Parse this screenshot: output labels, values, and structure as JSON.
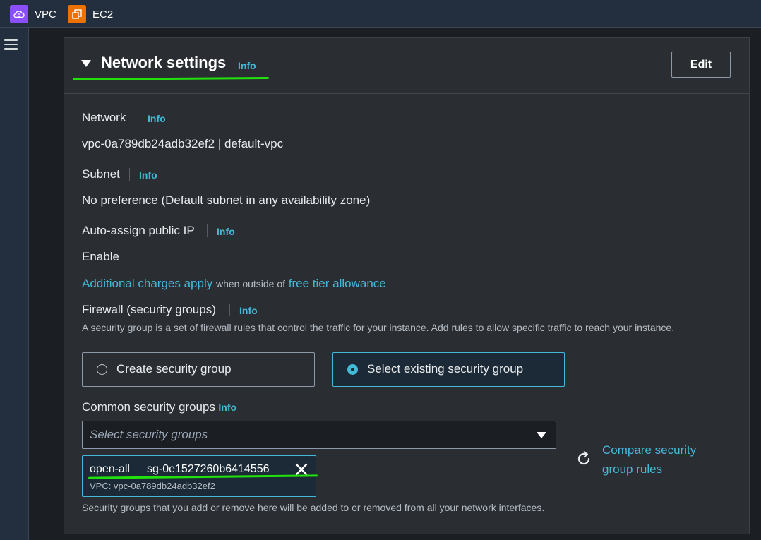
{
  "topbar": {
    "services": [
      {
        "label": "VPC",
        "icon": "vpc-cloud-icon",
        "color": "#8c4fff"
      },
      {
        "label": "EC2",
        "icon": "ec2-instance-icon",
        "color": "#ed7100"
      }
    ]
  },
  "sidebar": {
    "menu_icon": "hamburger-menu-icon"
  },
  "network_settings": {
    "title": "Network settings",
    "info": "Info",
    "edit_label": "Edit",
    "network": {
      "label": "Network",
      "info": "Info",
      "value": "vpc-0a789db24adb32ef2 | default-vpc"
    },
    "subnet": {
      "label": "Subnet",
      "info": "Info",
      "value": "No preference (Default subnet in any availability zone)"
    },
    "public_ip": {
      "label": "Auto-assign public IP",
      "info": "Info",
      "value": "Enable"
    },
    "charges": {
      "link1": "Additional charges apply",
      "text": "when outside of",
      "link2": "free tier allowance"
    },
    "firewall": {
      "label": "Firewall (security groups)",
      "info": "Info",
      "description": "A security group is a set of firewall rules that control the traffic for your instance. Add rules to allow specific traffic to reach your instance.",
      "options": [
        {
          "label": "Create security group",
          "selected": false
        },
        {
          "label": "Select existing security group",
          "selected": true
        }
      ]
    },
    "common_sg": {
      "label": "Common security groups",
      "info": "Info",
      "placeholder": "Select security groups",
      "selected": {
        "name": "open-all",
        "id": "sg-0e1527260b6414556",
        "vpc": "VPC: vpc-0a789db24adb32ef2"
      },
      "compare_link": {
        "line1": "Compare security",
        "line2": "group rules"
      },
      "footnote": "Security groups that you add or remove here will be added to or removed from all your network interfaces."
    }
  },
  "colors": {
    "accent": "#44b9d6",
    "annotation": "#22e00c",
    "background": "#1b1e23",
    "panel": "#2a2e33"
  }
}
